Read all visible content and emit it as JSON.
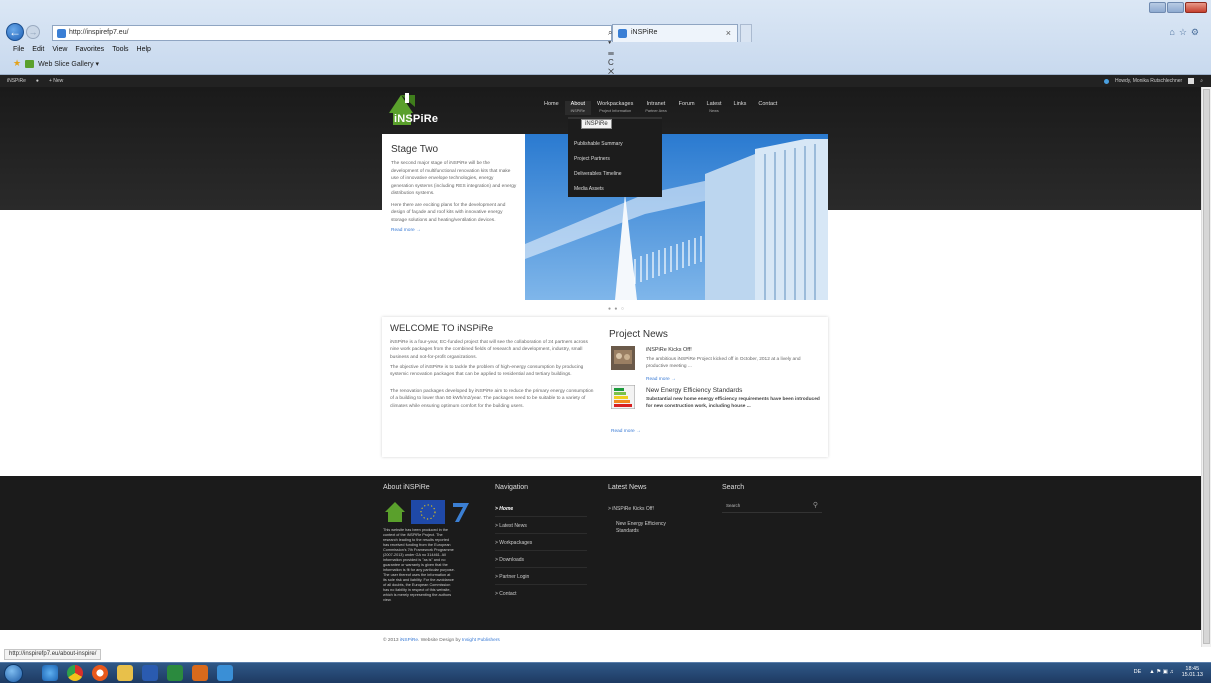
{
  "browser": {
    "url": "http://inspirefp7.eu/",
    "address_tools": "⌕ ▾ ☰ C ✕",
    "tab_title": "iNSPiRe",
    "tab_close": "×",
    "menu": [
      "File",
      "Edit",
      "View",
      "Favorites",
      "Tools",
      "Help"
    ],
    "favorites_item": "Web Slice Gallery ▾",
    "icons": [
      "home-icon",
      "star-icon",
      "gear-icon"
    ]
  },
  "adminbar": {
    "site": "iNSPiRe",
    "comment": "●",
    "new": "+ New",
    "howdy": "Howdy, Monika Rutschlechner",
    "search": "⌕"
  },
  "site": {
    "logo_text": "iNSPiRe",
    "nav": [
      {
        "label": "Home",
        "sub": ""
      },
      {
        "label": "About",
        "sub": "iNSPiRe"
      },
      {
        "label": "Workpackages",
        "sub": "Project Information"
      },
      {
        "label": "Intranet",
        "sub": "Partner Area"
      },
      {
        "label": "Forum",
        "sub": ""
      },
      {
        "label": "Latest",
        "sub": "News"
      },
      {
        "label": "Links",
        "sub": ""
      },
      {
        "label": "Contact",
        "sub": ""
      }
    ],
    "dropdown": {
      "tooltip": "iNSPiRe",
      "items": [
        "Publishable Summary",
        "Project Partners",
        "Deliverables Timeline",
        "Media Assets"
      ]
    },
    "slide": {
      "title": "Stage Two",
      "p1": "The second major stage of iNSPiRe will be the development of multifunctional renovation kits that make use of innovative envelope technologies, energy generation systems (including RES integration) and energy distribution systems.",
      "p2": "Here there are exciting plans for the development and design of façade and roof kits with innovative energy storage solutions and heating/ventilation devices.",
      "read_more": "Read more →",
      "dots": "● ● ○"
    },
    "welcome": {
      "title": "WELCOME TO iNSPiRe",
      "p1": "iNSPiRe is a four-year, EC-funded project that will see the collaboration of 24 partners across nine work packages from the combined fields of research and development, industry, small business and not-for-profit organizations.",
      "p2": "The objective of iNSPiRe is to tackle the problem of high-energy consumption by producing systemic renovation packages that can be applied to residential and tertiary buildings.",
      "p3": "The renovation packages developed by iNSPiRe aim to reduce the primary energy consumption of a building to lower than 50 kWh/m2/year. The packages need to be suitable to a variety of climates while ensuring optimum comfort for the building users."
    },
    "news": {
      "title": "Project News",
      "items": [
        {
          "head": "iNSPiRe Kicks Off!",
          "body": "The ambitious iNSPiRe Project kicked off in October, 2012 at a lively and productive meeting ...",
          "read_more": "Read more →"
        },
        {
          "head": "New Energy Efficiency Standards",
          "body": "Substantial new home energy efficiency requirements have been introduced for new construction work, including house ...",
          "read_more": "Read more →"
        }
      ]
    },
    "footer": {
      "about_title": "About iNSPiRe",
      "about_text": "This website has been produced in the context of the iNSPiRe Project. The research leading to the results reported has received funding from the European Commission's 7th Framework Programme (2007-2013) under GA no 314461. All information provided is \"as is\" and no guarantee or warranty is given that the information is fit for any particular purpose. The user thereof uses the information at its sole risk and liability. For the avoidance of all doubts, the European Commission has no liability in respect of this website, which is merely representing the authors view.",
      "nav_title": "Navigation",
      "nav": [
        "> Home",
        "> Latest News",
        "> Workpackages",
        "> Downloads",
        "> Partner Login",
        "> Contact"
      ],
      "news_title": "Latest News",
      "news": [
        "> iNSPiRe Kicks Off!",
        "New Energy Efficiency Standards"
      ],
      "search_title": "Search",
      "search_placeholder": "Search",
      "copyright_pre": "© 2013",
      "copyright_brand": "iNSPiRe",
      "copyright_mid": ". Website Design by",
      "copyright_agency": "Insight Publishers"
    }
  },
  "status_url": "http://inspirefp7.eu/about-inspire/",
  "taskbar": {
    "lang": "DE",
    "time": "18:45",
    "date": "15.01.13"
  },
  "colors": {
    "link": "#3a7bd5",
    "dark_band": "#1b1b1b",
    "logo_green": "#5aa02c"
  }
}
